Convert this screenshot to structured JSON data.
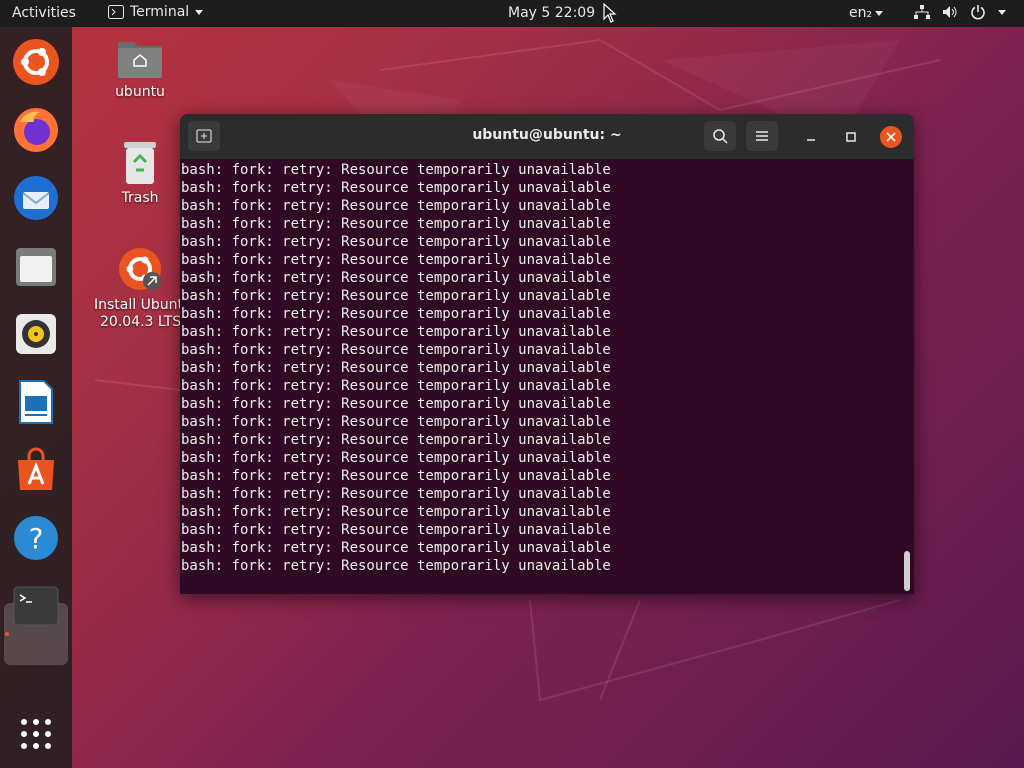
{
  "topbar": {
    "activities": "Activities",
    "app_name": "Terminal",
    "clock": "May 5  22:09",
    "lang": "en₂"
  },
  "dock": {
    "items": [
      "Ubuntu Software Center",
      "Firefox",
      "Thunderbird",
      "Files",
      "Rhythmbox",
      "LibreOffice Writer",
      "Ubuntu Software",
      "Help",
      "Terminal"
    ],
    "show_apps": "Show Applications"
  },
  "desktop": {
    "home_label": "ubuntu",
    "trash_label": "Trash",
    "install_label_1": "Install Ubuntu",
    "install_label_2": "20.04.3 LTS"
  },
  "terminal": {
    "title": "ubuntu@ubuntu: ~",
    "lines": [
      "bash: fork: retry: Resource temporarily unavailable",
      "bash: fork: retry: Resource temporarily unavailable",
      "bash: fork: retry: Resource temporarily unavailable",
      "bash: fork: retry: Resource temporarily unavailable",
      "bash: fork: retry: Resource temporarily unavailable",
      "bash: fork: retry: Resource temporarily unavailable",
      "bash: fork: retry: Resource temporarily unavailable",
      "bash: fork: retry: Resource temporarily unavailable",
      "bash: fork: retry: Resource temporarily unavailable",
      "bash: fork: retry: Resource temporarily unavailable",
      "bash: fork: retry: Resource temporarily unavailable",
      "bash: fork: retry: Resource temporarily unavailable",
      "bash: fork: retry: Resource temporarily unavailable",
      "bash: fork: retry: Resource temporarily unavailable",
      "bash: fork: retry: Resource temporarily unavailable",
      "bash: fork: retry: Resource temporarily unavailable",
      "bash: fork: retry: Resource temporarily unavailable",
      "bash: fork: retry: Resource temporarily unavailable",
      "bash: fork: retry: Resource temporarily unavailable",
      "bash: fork: retry: Resource temporarily unavailable",
      "bash: fork: retry: Resource temporarily unavailable",
      "bash: fork: retry: Resource temporarily unavailable",
      "bash: fork: retry: Resource temporarily unavailable"
    ]
  },
  "colors": {
    "accent": "#e95420",
    "terminal_bg": "#300a24",
    "topbar_bg": "#1d1d1d"
  }
}
